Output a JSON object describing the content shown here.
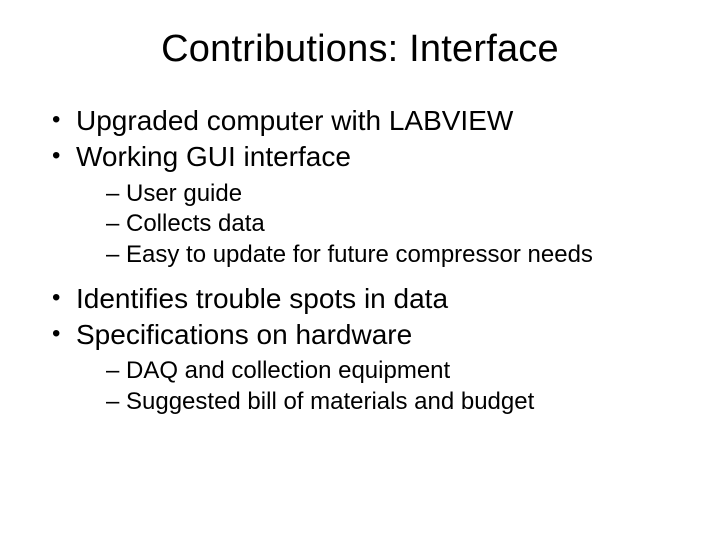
{
  "title": "Contributions: Interface",
  "bullets": [
    {
      "text": "Upgraded computer with LABVIEW",
      "children": []
    },
    {
      "text": "Working GUI interface",
      "children": [
        {
          "text": "User guide"
        },
        {
          "text": "Collects data"
        },
        {
          "text": "Easy to update for future compressor needs"
        }
      ]
    },
    {
      "text": "Identifies trouble spots in data",
      "children": []
    },
    {
      "text": "Specifications on hardware",
      "children": [
        {
          "text": "DAQ and collection equipment"
        },
        {
          "text": "Suggested bill of materials and budget"
        }
      ]
    }
  ]
}
